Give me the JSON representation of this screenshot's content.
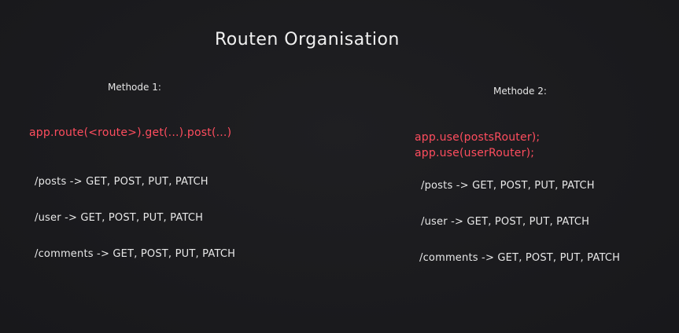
{
  "title": "Routen Organisation",
  "method1": {
    "heading": "Methode 1:",
    "code": "app.route(<route>).get(...).post(...)",
    "routes": [
      "/posts -> GET, POST, PUT, PATCH",
      "/user -> GET, POST, PUT, PATCH",
      "/comments -> GET, POST, PUT, PATCH"
    ]
  },
  "method2": {
    "heading": "Methode 2:",
    "code": [
      "app.use(postsRouter);",
      "app.use(userRouter);"
    ],
    "routes": [
      "/posts -> GET, POST, PUT, PATCH",
      "/user -> GET, POST, PUT, PATCH",
      "/comments -> GET, POST, PUT, PATCH"
    ]
  },
  "colors": {
    "background": "#1b1b1e",
    "text": "#ececec",
    "code": "#ff4d5e"
  }
}
